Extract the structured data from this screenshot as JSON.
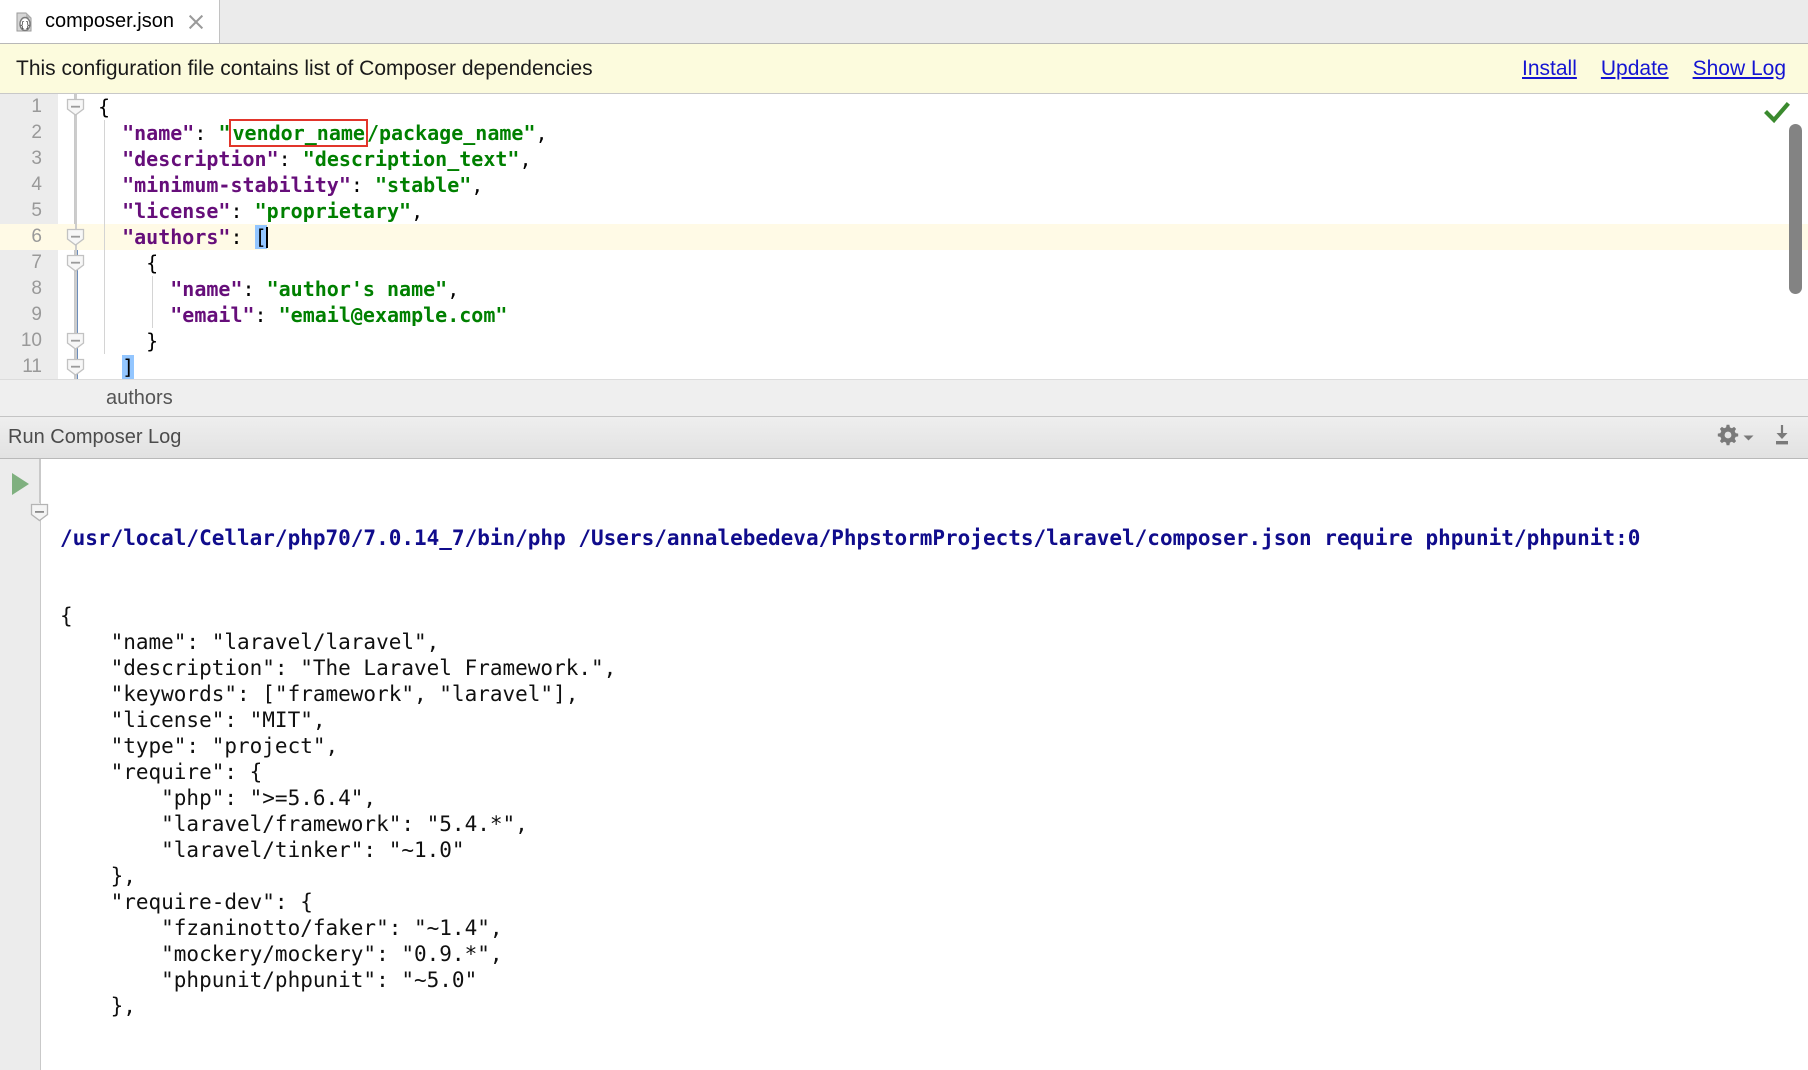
{
  "window": {
    "tab": {
      "label": "composer.json",
      "icon": "json-file-icon",
      "close_icon": "close-icon"
    }
  },
  "notification": {
    "message": "This configuration file contains list of Composer dependencies",
    "links": [
      {
        "label": "Install",
        "name": "install-link"
      },
      {
        "label": "Update",
        "name": "update-link"
      },
      {
        "label": "Show Log",
        "name": "show-log-link"
      }
    ],
    "background": "#fcfbdd",
    "link_color": "#1414d2"
  },
  "editor": {
    "status_icon": "green-check-icon",
    "current_line": 6,
    "caret_line": 6,
    "template_highlight": "vendor_name",
    "lines": [
      {
        "num": "1",
        "segments": [
          {
            "t": "{",
            "c": "p"
          }
        ]
      },
      {
        "num": "2",
        "segments": [
          {
            "t": "  ",
            "c": "p"
          },
          {
            "t": "\"name\"",
            "c": "k"
          },
          {
            "t": ": ",
            "c": "p"
          },
          {
            "t": "\"",
            "c": "s"
          },
          {
            "t": "vendor_name",
            "c": "s tmpl"
          },
          {
            "t": "/package_name\"",
            "c": "s"
          },
          {
            "t": ",",
            "c": "p"
          }
        ]
      },
      {
        "num": "3",
        "segments": [
          {
            "t": "  ",
            "c": "p"
          },
          {
            "t": "\"description\"",
            "c": "k"
          },
          {
            "t": ": ",
            "c": "p"
          },
          {
            "t": "\"description_text\"",
            "c": "s"
          },
          {
            "t": ",",
            "c": "p"
          }
        ]
      },
      {
        "num": "4",
        "segments": [
          {
            "t": "  ",
            "c": "p"
          },
          {
            "t": "\"minimum-stability\"",
            "c": "k"
          },
          {
            "t": ": ",
            "c": "p"
          },
          {
            "t": "\"stable\"",
            "c": "s"
          },
          {
            "t": ",",
            "c": "p"
          }
        ]
      },
      {
        "num": "5",
        "segments": [
          {
            "t": "  ",
            "c": "p"
          },
          {
            "t": "\"license\"",
            "c": "k"
          },
          {
            "t": ": ",
            "c": "p"
          },
          {
            "t": "\"proprietary\"",
            "c": "s"
          },
          {
            "t": ",",
            "c": "p"
          }
        ]
      },
      {
        "num": "6",
        "segments": [
          {
            "t": "  ",
            "c": "p"
          },
          {
            "t": "\"authors\"",
            "c": "k"
          },
          {
            "t": ": ",
            "c": "p"
          },
          {
            "t": "[",
            "c": "p brace"
          }
        ]
      },
      {
        "num": "7",
        "segments": [
          {
            "t": "    {",
            "c": "p"
          }
        ]
      },
      {
        "num": "8",
        "segments": [
          {
            "t": "      ",
            "c": "p"
          },
          {
            "t": "\"name\"",
            "c": "k"
          },
          {
            "t": ": ",
            "c": "p"
          },
          {
            "t": "\"author's name\"",
            "c": "s"
          },
          {
            "t": ",",
            "c": "p"
          }
        ]
      },
      {
        "num": "9",
        "segments": [
          {
            "t": "      ",
            "c": "p"
          },
          {
            "t": "\"email\"",
            "c": "k"
          },
          {
            "t": ": ",
            "c": "p"
          },
          {
            "t": "\"email@example.com\"",
            "c": "s"
          }
        ]
      },
      {
        "num": "10",
        "segments": [
          {
            "t": "    }",
            "c": "p"
          }
        ]
      },
      {
        "num": "11",
        "segments": [
          {
            "t": "  ",
            "c": "p"
          },
          {
            "t": "]",
            "c": "p brace"
          }
        ]
      }
    ]
  },
  "breadcrumb": {
    "items": [
      "authors"
    ]
  },
  "tool_window": {
    "title": "Run Composer Log",
    "actions": [
      {
        "name": "settings-gear-button",
        "icon": "gear-icon"
      },
      {
        "name": "export-log-button",
        "icon": "download-icon"
      }
    ]
  },
  "console": {
    "run_icon": "run-play-icon",
    "command": "/usr/local/Cellar/php70/7.0.14_7/bin/php /Users/annalebedeva/PhpstormProjects/laravel/composer.json require phpunit/phpunit:0",
    "lines": [
      "{",
      "    \"name\": \"laravel/laravel\",",
      "    \"description\": \"The Laravel Framework.\",",
      "    \"keywords\": [\"framework\", \"laravel\"],",
      "    \"license\": \"MIT\",",
      "    \"type\": \"project\",",
      "    \"require\": {",
      "        \"php\": \">=5.6.4\",",
      "        \"laravel/framework\": \"5.4.*\",",
      "        \"laravel/tinker\": \"~1.0\"",
      "    },",
      "    \"require-dev\": {",
      "        \"fzaninotto/faker\": \"~1.4\",",
      "        \"mockery/mockery\": \"0.9.*\",",
      "        \"phpunit/phpunit\": \"~5.0\"",
      "    },"
    ]
  }
}
